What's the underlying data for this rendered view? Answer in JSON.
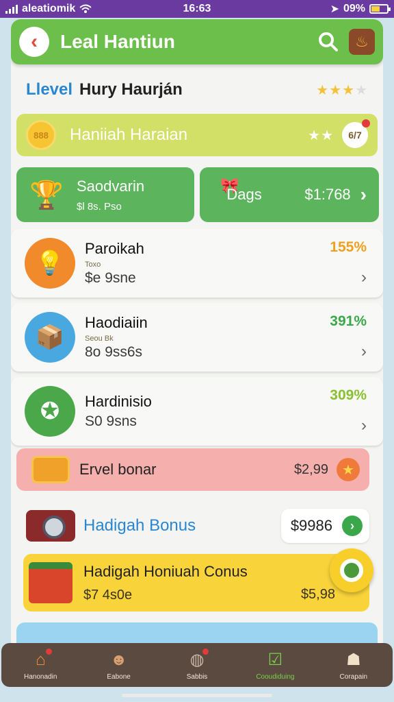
{
  "status_bar": {
    "carrier": "aleatiomik",
    "time": "16:63",
    "battery": "09%"
  },
  "header": {
    "title": "Leal Hantiun",
    "icons": [
      "back-icon",
      "search-icon",
      "basket-icon"
    ]
  },
  "level": {
    "label": "Llevel",
    "name": "Hury Haurján",
    "stars": 3
  },
  "daily_reward": {
    "title": "Haniiah Haraian",
    "coin_text": "888",
    "stars": 2,
    "badge": "6/7"
  },
  "cards": {
    "left": {
      "title": "Saodvarin",
      "subtitle": "$l 8s. Pso"
    },
    "right": {
      "label": "Dags",
      "value": "$1:768"
    }
  },
  "rewards": [
    {
      "title": "Paroikah",
      "subtitle": "Toxo",
      "amount": "$e 9sne",
      "percent": "155%",
      "percent_color": "#f0a020"
    },
    {
      "title": "Haodiaiin",
      "subtitle": "Seou Bk",
      "amount": "8o 9ss6s",
      "percent": "391%",
      "percent_color": "#3aa84a"
    },
    {
      "title": "Hardinisio",
      "subtitle": "",
      "amount": "S0 9sns",
      "percent": "309%",
      "percent_color": "#8ac030"
    }
  ],
  "bonuses": {
    "pink": {
      "title": "Ervel bonar",
      "value": "$2,99"
    },
    "white": {
      "title": "Hadigah Bonus",
      "value": "$9986"
    },
    "yellow": {
      "title": "Hadigah Honiuah Conus",
      "subtitle": "$7 4s0e",
      "value": "$5,98"
    }
  },
  "bottom_nav": [
    {
      "label": "Hanonadin",
      "icon": "home-icon"
    },
    {
      "label": "Eabone",
      "icon": "friends-icon"
    },
    {
      "label": "Sabbis",
      "icon": "globe-icon"
    },
    {
      "label": "Cooudiduing",
      "icon": "checklist-icon"
    },
    {
      "label": "Corapain",
      "icon": "profile-icon"
    }
  ]
}
